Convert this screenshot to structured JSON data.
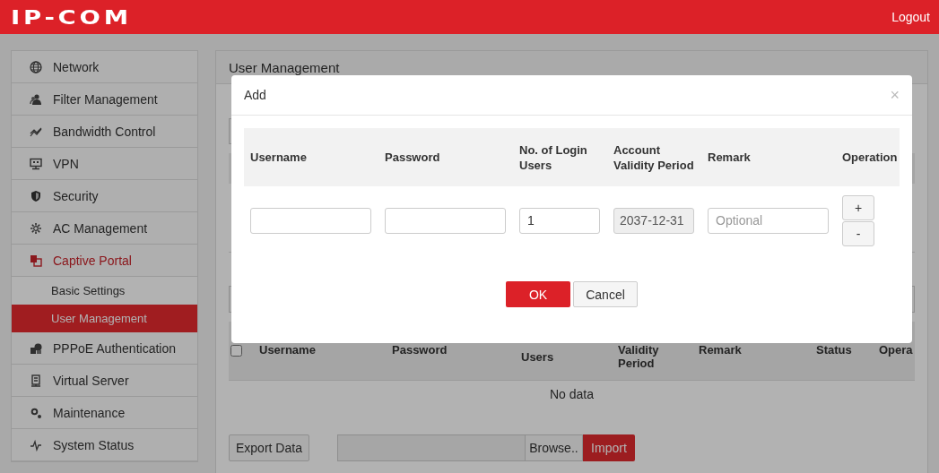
{
  "header": {
    "logo": "IP-COM",
    "logout": "Logout"
  },
  "sidebar": {
    "items": [
      {
        "label": "Network",
        "selected": false
      },
      {
        "label": "Filter Management",
        "selected": false
      },
      {
        "label": "Bandwidth Control",
        "selected": false
      },
      {
        "label": "VPN",
        "selected": false
      },
      {
        "label": "Security",
        "selected": false
      },
      {
        "label": "AC Management",
        "selected": false
      },
      {
        "label": "Captive Portal",
        "selected": true,
        "children": [
          {
            "label": "Basic Settings",
            "selected": false
          },
          {
            "label": "User Management",
            "selected": true
          }
        ]
      },
      {
        "label": "PPPoE Authentication",
        "selected": false
      },
      {
        "label": "Virtual Server",
        "selected": false
      },
      {
        "label": "Maintenance",
        "selected": false
      },
      {
        "label": "System Status",
        "selected": false
      }
    ]
  },
  "panel": {
    "title": "User Management",
    "table": {
      "select_all_checked": false,
      "columns": [
        "Username",
        "Password",
        "Users",
        "Validity Period",
        "Remark",
        "Status",
        "Opera"
      ],
      "empty_text": "No data"
    },
    "export_button": "Export Data",
    "browse_button": "Browse..",
    "import_button": "Import"
  },
  "dialog": {
    "title": "Add",
    "close": "×",
    "columns": [
      "Username",
      "Password",
      "No. of Login Users",
      "Account Validity Period",
      "Remark",
      "Operation"
    ],
    "row": {
      "login_users": "1",
      "validity": {
        "value": "2037-12-31",
        "disabled": true
      },
      "remark_placeholder": "Optional",
      "add": "+",
      "remove": "-"
    },
    "ok_button": "OK",
    "cancel_button": "Cancel"
  }
}
